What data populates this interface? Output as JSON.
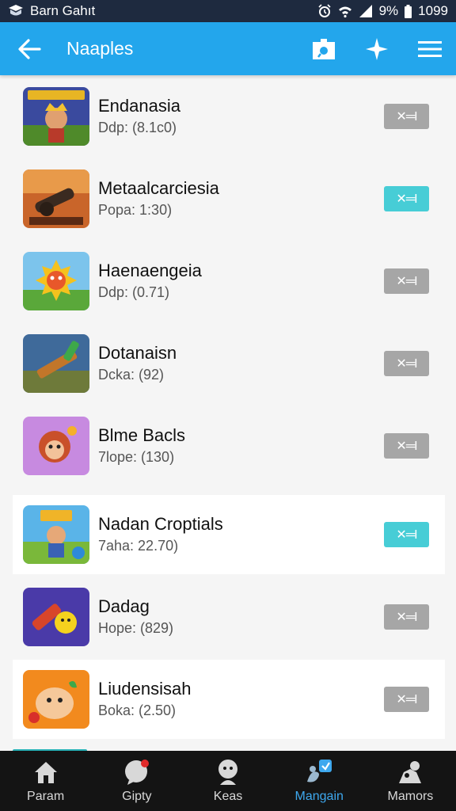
{
  "status_bar": {
    "carrier": "Barn Gahıt",
    "battery": "9%",
    "time": "1099"
  },
  "app_bar": {
    "title": "Naaples"
  },
  "items": [
    {
      "name": "Endanasia",
      "meta": "Ddp: (8.1c0)",
      "toggle_label": "✕═I",
      "toggle_on": false,
      "icon": "warrior-game-icon"
    },
    {
      "name": "Metaalcarciesia",
      "meta": "Popa: 1:30)",
      "toggle_label": "✕═I",
      "toggle_on": true,
      "icon": "cannon-game-icon"
    },
    {
      "name": "Haenaengeia",
      "meta": "Ddp: (0.71)",
      "toggle_label": "✕═I",
      "toggle_on": false,
      "icon": "sun-monster-game-icon"
    },
    {
      "name": "Dotanaisn",
      "meta": "Dcka: (92)",
      "toggle_label": "✕═I",
      "toggle_on": false,
      "icon": "sword-game-icon"
    },
    {
      "name": "Blme Bacls",
      "meta": "7lope: (130)",
      "toggle_label": "✕═I",
      "toggle_on": false,
      "icon": "monkey-game-icon"
    },
    {
      "name": "Nadan Croptials",
      "meta": "7aha: 22.70)",
      "toggle_label": "✕═I",
      "toggle_on": true,
      "icon": "hero-game-icon"
    },
    {
      "name": "Dadag",
      "meta": "Hope: (829)",
      "toggle_label": "✕═I",
      "toggle_on": false,
      "icon": "chick-game-icon"
    },
    {
      "name": "Liudensisah",
      "meta": "Boka: (2.50)",
      "toggle_label": "✕═I",
      "toggle_on": false,
      "icon": "frog-game-icon"
    }
  ],
  "bottom_nav": [
    {
      "label": "Param",
      "icon": "home-icon",
      "active": false
    },
    {
      "label": "Gipty",
      "icon": "chat-icon",
      "active": false
    },
    {
      "label": "Keas",
      "icon": "character-icon",
      "active": false
    },
    {
      "label": "Mangain",
      "icon": "manage-icon",
      "active": true
    },
    {
      "label": "Mamors",
      "icon": "group-icon",
      "active": false
    }
  ],
  "colors": {
    "app_bar": "#23a6ec",
    "status_bar": "#1e2a3f",
    "toggle_on": "#47cdd6",
    "toggle_off": "#a6a6a6",
    "nav_active": "#3ea8ee"
  }
}
